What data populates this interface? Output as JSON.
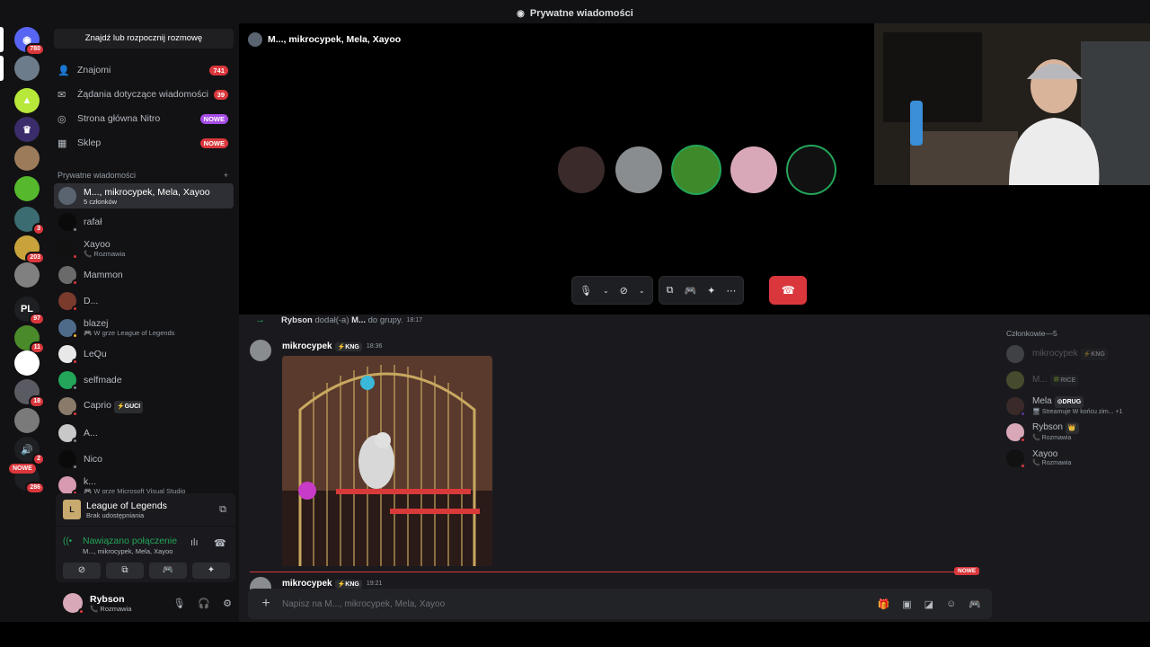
{
  "topbar": {
    "title": "Prywatne wiadomości"
  },
  "servers": [
    {
      "name": "discord-home",
      "badge": "780",
      "color": "#5865f2",
      "glyph": "◉"
    },
    {
      "name": "group-dm",
      "badge": "",
      "color": "#6d7c8a",
      "glyph": ""
    },
    {
      "name": "server-green",
      "badge": "",
      "color": "#b7e83a",
      "glyph": "▲"
    },
    {
      "name": "server-purple",
      "badge": "",
      "color": "#3b2d6b",
      "glyph": "♛"
    },
    {
      "name": "server-face",
      "badge": "",
      "color": "#9c7b5b",
      "glyph": ""
    },
    {
      "name": "server-apple",
      "badge": "",
      "color": "#55b82d",
      "glyph": ""
    },
    {
      "name": "server-crew",
      "badge": "3",
      "color": "#3a6c72",
      "glyph": ""
    },
    {
      "name": "server-gold",
      "badge": "203",
      "color": "#c9a23b",
      "glyph": ""
    },
    {
      "name": "server-troll",
      "badge": "",
      "color": "#808080",
      "glyph": ""
    },
    {
      "name": "server-pl",
      "badge": "97",
      "color": "#1e1f22",
      "glyph": "PL"
    },
    {
      "name": "server-pepe",
      "badge": "11",
      "color": "#4b8a2a",
      "glyph": ""
    },
    {
      "name": "server-ninja",
      "badge": "",
      "color": "#ffffff",
      "glyph": "N"
    },
    {
      "name": "server-city",
      "badge": "18",
      "color": "#5a5a62",
      "glyph": ""
    },
    {
      "name": "server-troll2",
      "badge": "",
      "color": "#7a7a7a",
      "glyph": ""
    },
    {
      "name": "server-mic",
      "badge": "2",
      "color": "#1e1f22",
      "glyph": "🔊"
    },
    {
      "name": "server-new",
      "badge": "286",
      "color": "#1e1f22",
      "glyph": ""
    }
  ],
  "new_label": "NOWE",
  "dm": {
    "search": "Znajdź lub rozpocznij rozmowę",
    "nav": [
      {
        "label": "Znajomi",
        "badge": "741",
        "icon": "👤",
        "badge_color": "#da373c"
      },
      {
        "label": "Żądania dotyczące wiadomości",
        "badge": "39",
        "icon": "✉",
        "badge_color": "#da373c"
      },
      {
        "label": "Strona główna Nitro",
        "badge": "NOWE",
        "icon": "◎",
        "badge_color": "#a64ce6"
      },
      {
        "label": "Sklep",
        "badge": "NOWE",
        "icon": "▦",
        "badge_color": "#da373c"
      }
    ],
    "section": "Prywatne wiadomości",
    "section_plus": "+",
    "items": [
      {
        "name": "M..., mikrocypek, Mela, Xayoo",
        "sub": "5 członków",
        "color": "#5a6470",
        "status": ""
      },
      {
        "name": "rafał",
        "sub": "",
        "color": "#0a0a0a",
        "status": "#80848e"
      },
      {
        "name": "Xayoo",
        "sub": "📞 Rozmawia",
        "color": "#111",
        "status": "#da373c"
      },
      {
        "name": "Mammon",
        "sub": "",
        "color": "#6a6a6a",
        "status": "#da373c"
      },
      {
        "name": "D...",
        "sub": "",
        "color": "#7a3b2d",
        "status": "#da373c"
      },
      {
        "name": "blazej",
        "sub": "🎮 W grze League of Legends",
        "color": "#4f6b8a",
        "status": "#f0b232"
      },
      {
        "name": "LeQu",
        "sub": "",
        "color": "#e8e8e8",
        "status": "#da373c"
      },
      {
        "name": "selfmade",
        "sub": "",
        "color": "#23a55a",
        "status": "#80848e"
      },
      {
        "name": "Caprio",
        "sub": "",
        "color": "#8a7a6a",
        "status": "#da373c",
        "tag": "⚡GUCI"
      },
      {
        "name": "A...",
        "sub": "",
        "color": "#c8c8c8",
        "status": "#80848e"
      },
      {
        "name": "Nico",
        "sub": "",
        "color": "#0a0a0a",
        "status": "#80848e"
      },
      {
        "name": "k...",
        "sub": "🎮 W grze Microsoft Visual Studio",
        "color": "#d89ab0",
        "status": "#da373c"
      }
    ],
    "activity": {
      "title": "League of Legends",
      "sub": "Brak udostępniania",
      "logo": "L"
    },
    "voice": {
      "status": "Nawiązano połączenie",
      "channel": "M..., mikrocypek, Mela, Xayoo"
    },
    "user": {
      "name": "Rybson",
      "sub": "📞 Rozmawia"
    }
  },
  "call": {
    "title": "M..., mikrocypek, Mela, Xayoo",
    "participants": [
      {
        "name": "participant-1",
        "color": "#3a2a2a",
        "speaking": false
      },
      {
        "name": "participant-2",
        "color": "#8a8d90",
        "speaking": false
      },
      {
        "name": "participant-3",
        "color": "#3e8a2a",
        "speaking": true
      },
      {
        "name": "participant-4",
        "color": "#d8a8b8",
        "speaking": false
      },
      {
        "name": "participant-5",
        "color": "#111111",
        "speaking": true
      }
    ]
  },
  "chat": {
    "system": {
      "actor": "Rybson",
      "text": "dodał(-a)",
      "target": "M...",
      "text2": "do grupy.",
      "time": "18:17"
    },
    "messages": [
      {
        "author": "mikrocypek",
        "tag": "⚡KNG",
        "time": "18:36"
      },
      {
        "author": "mikrocypek",
        "tag": "⚡KNG",
        "time": "19:21"
      }
    ],
    "new_label": "NOWE",
    "composer_placeholder": "Napisz na M..., mikrocypek, Mela, Xayoo"
  },
  "members": {
    "title": "Członkowie—5",
    "list": [
      {
        "name": "mikrocypek",
        "tag": "⚡KNG",
        "sub": "",
        "color": "#8a8d90",
        "faded": true,
        "status": ""
      },
      {
        "name": "M...",
        "tag": "🍀RICE",
        "sub": "",
        "color": "#9aaa4a",
        "faded": true,
        "status": ""
      },
      {
        "name": "Mela",
        "tag": "⊙DRUG",
        "sub": "🖥 Streamuje W końcu zim... +1",
        "color": "#3a2a2a",
        "faded": false,
        "status": "#593695"
      },
      {
        "name": "Rybson",
        "tag": "👑",
        "sub": "📞 Rozmawia",
        "color": "#d8a8b8",
        "faded": false,
        "status": "#da373c"
      },
      {
        "name": "Xayoo",
        "tag": "",
        "sub": "📞 Rozmawia",
        "color": "#111111",
        "faded": false,
        "status": "#da373c"
      }
    ]
  }
}
